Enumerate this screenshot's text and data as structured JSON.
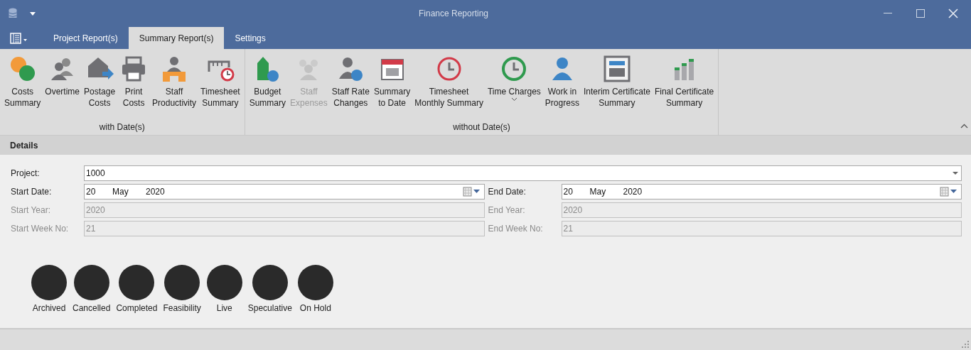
{
  "window": {
    "title": "Finance Reporting"
  },
  "tabs": [
    {
      "label": "Project Report(s)",
      "selected": false
    },
    {
      "label": "Summary Report(s)",
      "selected": true
    },
    {
      "label": "Settings",
      "selected": false
    }
  ],
  "ribbon_groups": [
    {
      "label": "with Date(s)",
      "buttons": [
        {
          "kind": "coins",
          "label": [
            "Costs",
            "Summary"
          ],
          "disabled": false,
          "dropdown": false
        },
        {
          "kind": "people",
          "label": [
            "Overtime"
          ],
          "disabled": false,
          "dropdown": false
        },
        {
          "kind": "envelope",
          "label": [
            "Postage",
            "Costs"
          ],
          "disabled": false,
          "dropdown": false
        },
        {
          "kind": "printer",
          "label": [
            "Print",
            "Costs"
          ],
          "disabled": false,
          "dropdown": false
        },
        {
          "kind": "desk",
          "label": [
            "Staff",
            "Productivity"
          ],
          "disabled": false,
          "dropdown": false
        },
        {
          "kind": "ruler",
          "label": [
            "Timesheet",
            "Summary"
          ],
          "disabled": false,
          "dropdown": false
        }
      ]
    },
    {
      "label": "without Date(s)",
      "buttons": [
        {
          "kind": "tag",
          "label": [
            "Budget",
            "Summary"
          ],
          "disabled": false,
          "dropdown": false
        },
        {
          "kind": "group",
          "label": [
            "Staff",
            "Expenses"
          ],
          "disabled": true,
          "dropdown": false
        },
        {
          "kind": "info",
          "label": [
            "Staff Rate",
            "Changes"
          ],
          "disabled": false,
          "dropdown": false
        },
        {
          "kind": "calendar",
          "label": [
            "Summary",
            "to Date"
          ],
          "disabled": false,
          "dropdown": false
        },
        {
          "kind": "clockred",
          "label": [
            "Timesheet",
            "Monthly Summary"
          ],
          "disabled": false,
          "dropdown": false
        },
        {
          "kind": "clockgreen",
          "label": [
            "Time Charges"
          ],
          "disabled": false,
          "dropdown": true
        },
        {
          "kind": "person",
          "label": [
            "Work in",
            "Progress"
          ],
          "disabled": false,
          "dropdown": false
        },
        {
          "kind": "calculator",
          "label": [
            "Interim Certificate",
            "Summary"
          ],
          "disabled": false,
          "dropdown": false
        },
        {
          "kind": "bars",
          "label": [
            "Final Certificate",
            "Summary"
          ],
          "disabled": false,
          "dropdown": false
        }
      ]
    }
  ],
  "details": {
    "title": "Details",
    "project": {
      "label": "Project:",
      "value": "1000"
    },
    "start_date": {
      "label": "Start Date:",
      "day": "20",
      "month": "May",
      "year": "2020"
    },
    "end_date": {
      "label": "End Date:",
      "day": "20",
      "month": "May",
      "year": "2020"
    },
    "start_year": {
      "label": "Start Year:",
      "value": "2020",
      "disabled": true
    },
    "end_year": {
      "label": "End Year:",
      "value": "2020",
      "disabled": true
    },
    "start_week": {
      "label": "Start Week No:",
      "value": "21",
      "disabled": true
    },
    "end_week": {
      "label": "End Week No:",
      "value": "21",
      "disabled": true
    }
  },
  "legend": [
    {
      "label": "Archived"
    },
    {
      "label": "Cancelled"
    },
    {
      "label": "Completed"
    },
    {
      "label": "Feasibility"
    },
    {
      "label": "Live"
    },
    {
      "label": "Speculative"
    },
    {
      "label": "On Hold"
    }
  ]
}
